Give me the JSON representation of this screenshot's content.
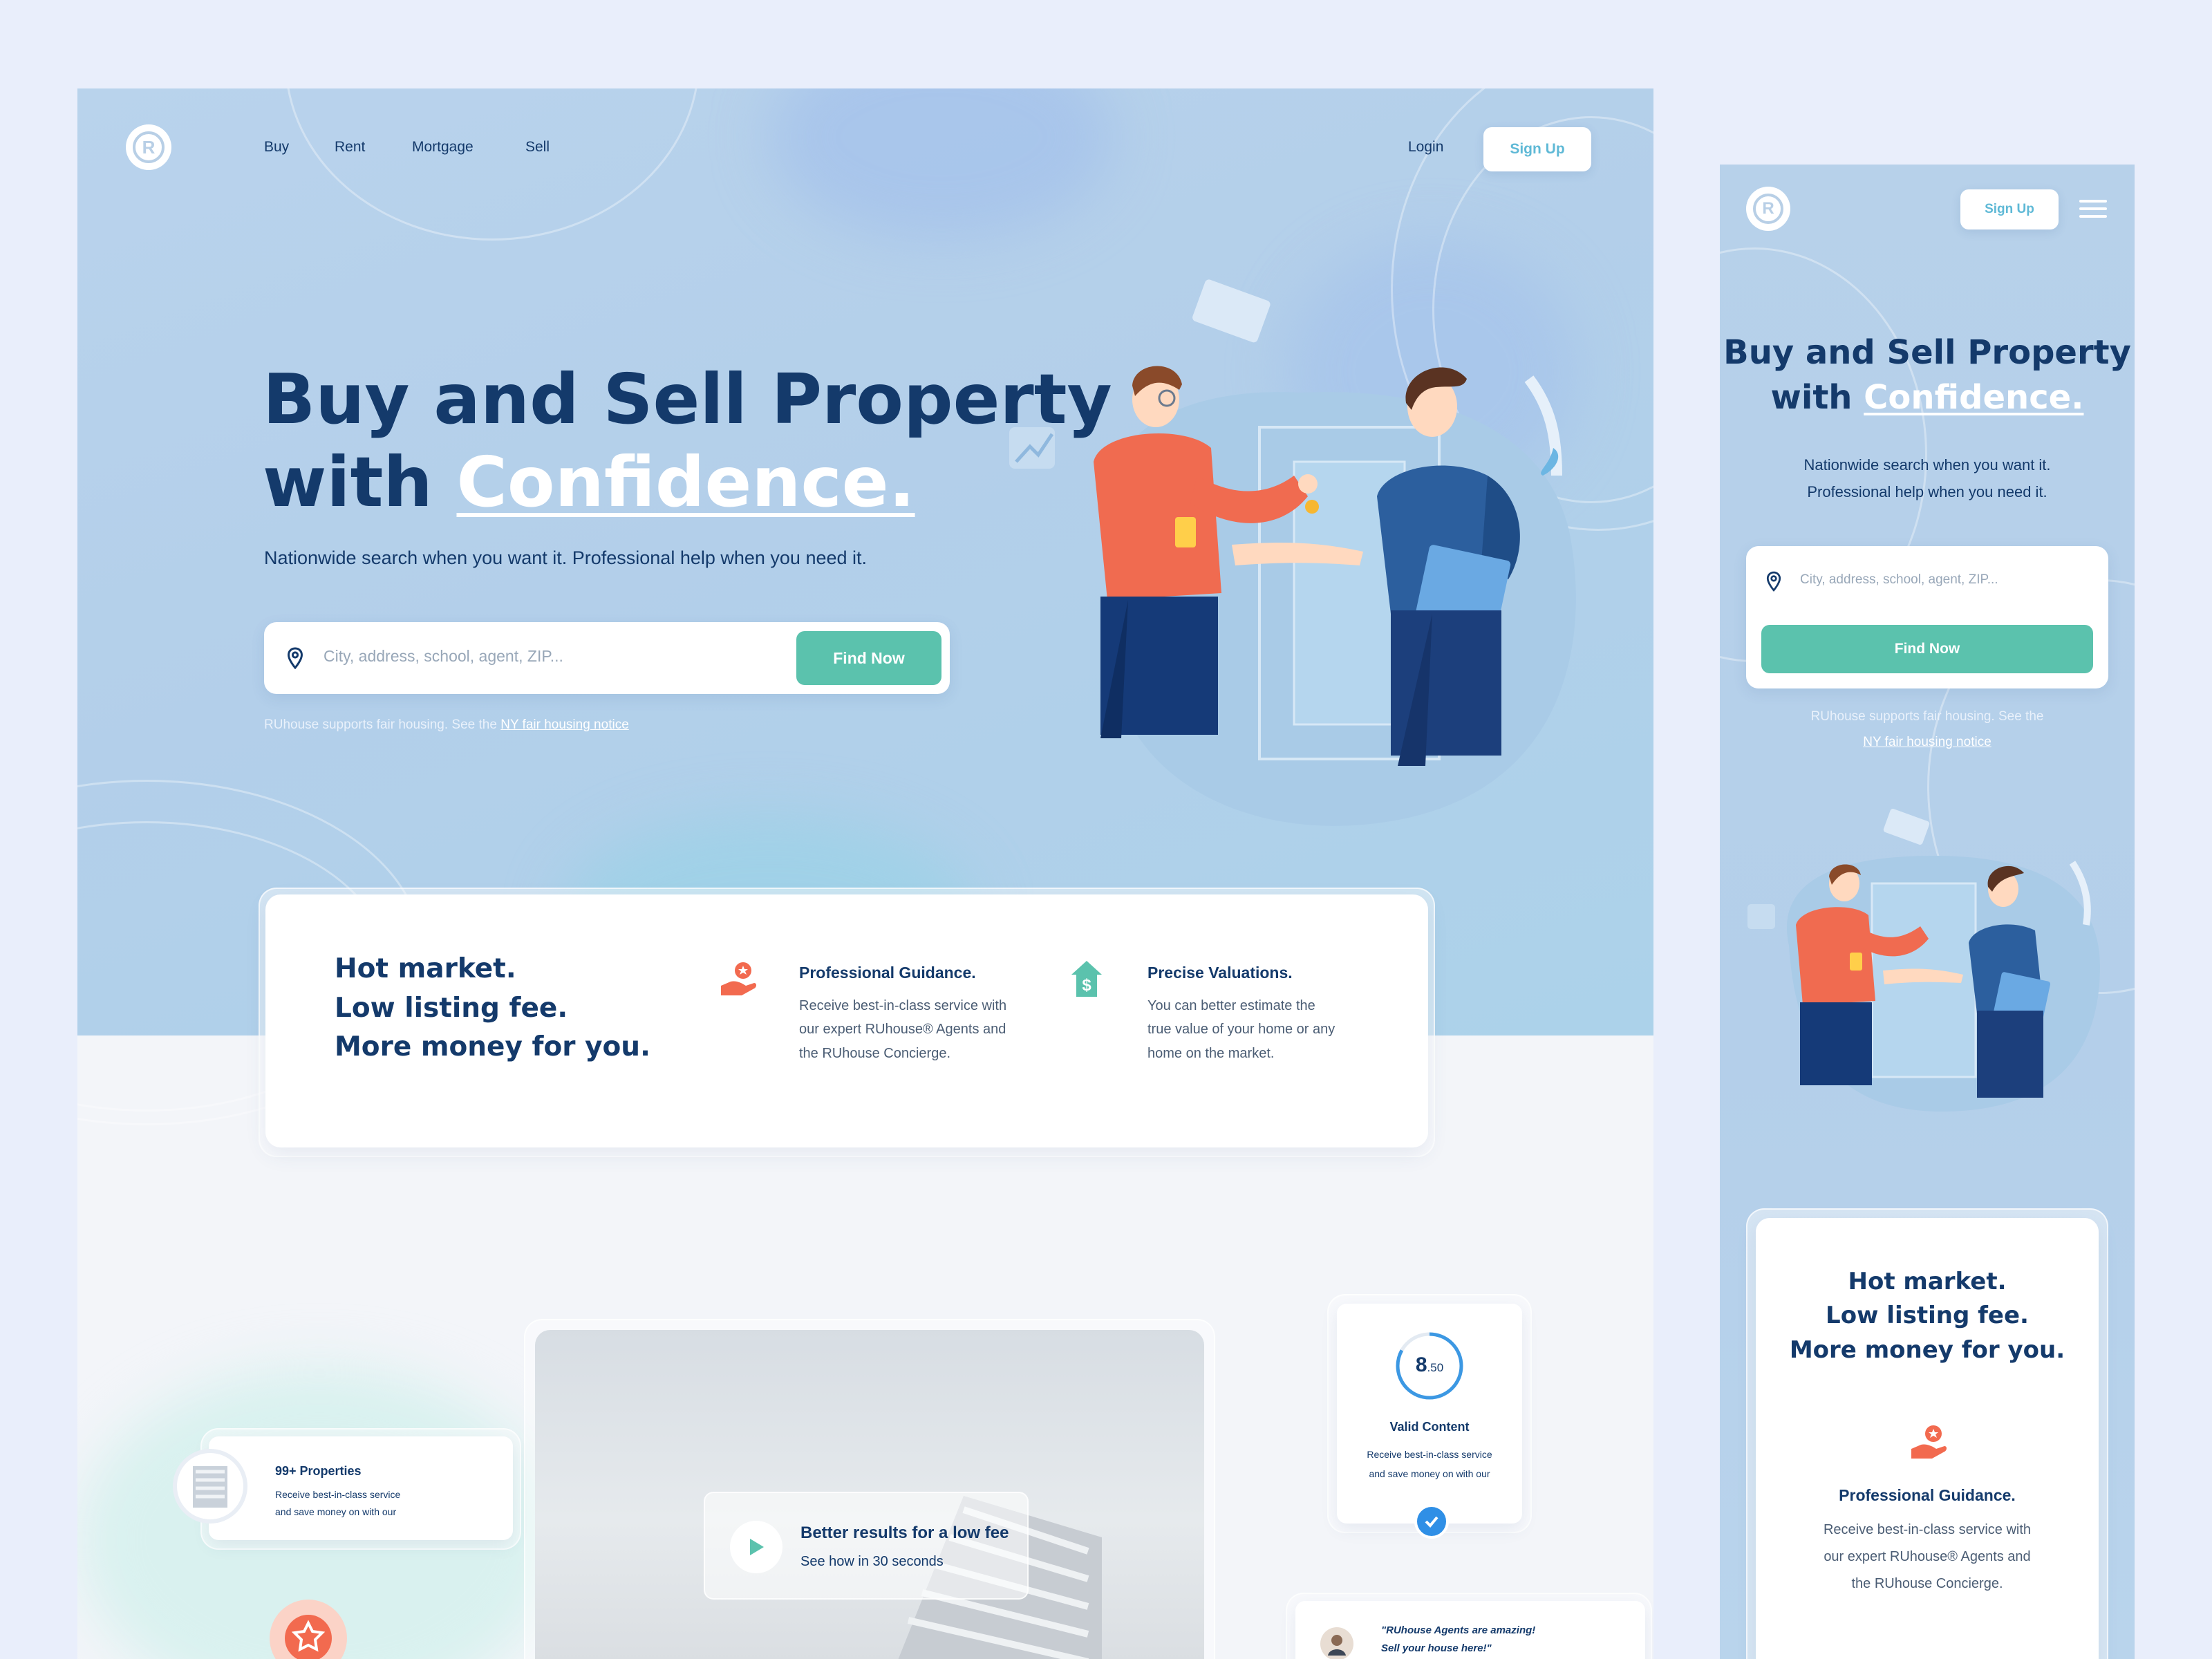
{
  "brand": {
    "logo_letter": "R",
    "accent": "#5bc2ad",
    "navy": "#143a6b",
    "hero_bg": "#b7d1ea",
    "orange": "#f26a4f"
  },
  "desktop": {
    "nav": {
      "items": [
        "Buy",
        "Rent",
        "Mortgage",
        "Sell"
      ],
      "login": "Login",
      "signup": "Sign Up"
    },
    "hero": {
      "title_line1": "Buy and Sell Property",
      "title_with": "with",
      "title_highlight": "Confidence.",
      "subtitle": "Nationwide search when you want it. Professional help when you need it.",
      "search_placeholder": "City, address, school, agent, ZIP...",
      "search_button": "Find Now",
      "fair_text": "RUhouse supports fair housing. See the",
      "fair_link": "NY fair housing notice"
    },
    "features": {
      "headline": [
        "Hot market.",
        "Low listing fee.",
        "More money for you."
      ],
      "items": [
        {
          "icon": "hand-star-icon",
          "title": "Professional Guidance.",
          "lines": [
            "Receive best-in-class service with",
            "our expert RUhouse® Agents and",
            "the RUhouse Concierge."
          ]
        },
        {
          "icon": "dollar-tag-icon",
          "title": "Precise Valuations.",
          "lines": [
            "You can better estimate the",
            "true value of your home or any",
            "home on the market."
          ]
        }
      ]
    },
    "showcase": {
      "properties_title": "99+ Properties",
      "properties_lines": [
        "Receive best-in-class service",
        "and save money on with our"
      ],
      "video_title": "Better results for a low fee",
      "video_sub": "See how in 30 seconds",
      "score_main": "8",
      "score_frac": ".50",
      "score_title": "Valid Content",
      "score_lines": [
        "Receive best-in-class service",
        "and save money on with our"
      ],
      "quote_lines": [
        "\"RUhouse Agents are amazing!",
        "Sell your house here!\""
      ]
    }
  },
  "mobile": {
    "signup": "Sign Up",
    "title_line1": "Buy and Sell Property",
    "title_with": "with",
    "title_highlight": "Confidence.",
    "subtitle_lines": [
      "Nationwide search when you want it.",
      "Professional help when you need it."
    ],
    "search_placeholder": "City, address, school, agent, ZIP...",
    "search_button": "Find Now",
    "fair_text": "RUhouse supports fair housing. See the",
    "fair_link": "NY fair housing notice",
    "headline": [
      "Hot market.",
      "Low listing fee.",
      "More money for you."
    ],
    "feature_title": "Professional Guidance.",
    "feature_lines": [
      "Receive best-in-class service with",
      "our expert RUhouse® Agents and",
      "the RUhouse Concierge."
    ]
  }
}
